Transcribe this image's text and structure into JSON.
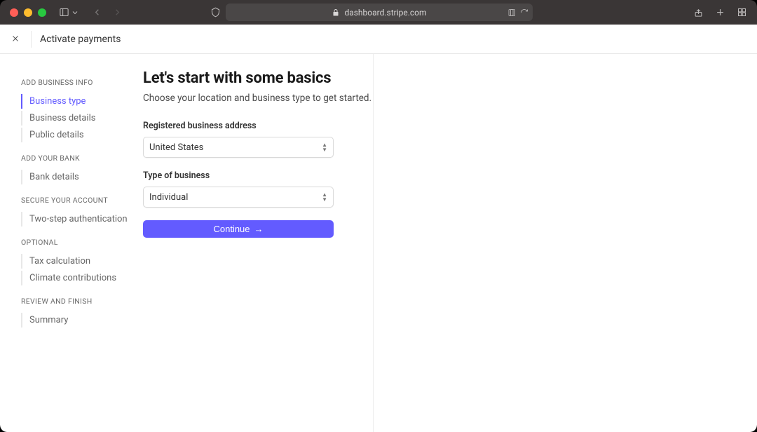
{
  "browser": {
    "url": "dashboard.stripe.com"
  },
  "header": {
    "title": "Activate payments"
  },
  "sidebar": {
    "sections": [
      {
        "title": "ADD BUSINESS INFO",
        "items": [
          {
            "label": "Business type",
            "active": true
          },
          {
            "label": "Business details",
            "active": false
          },
          {
            "label": "Public details",
            "active": false
          }
        ]
      },
      {
        "title": "ADD YOUR BANK",
        "items": [
          {
            "label": "Bank details",
            "active": false
          }
        ]
      },
      {
        "title": "SECURE YOUR ACCOUNT",
        "items": [
          {
            "label": "Two-step authentication",
            "active": false
          }
        ]
      },
      {
        "title": "OPTIONAL",
        "items": [
          {
            "label": "Tax calculation",
            "active": false
          },
          {
            "label": "Climate contributions",
            "active": false
          }
        ]
      },
      {
        "title": "REVIEW AND FINISH",
        "items": [
          {
            "label": "Summary",
            "active": false
          }
        ]
      }
    ]
  },
  "main": {
    "heading": "Let's start with some basics",
    "subheading": "Choose your location and business type to get started.",
    "fields": {
      "address_label": "Registered business address",
      "address_value": "United States",
      "type_label": "Type of business",
      "type_value": "Individual"
    },
    "continue_label": "Continue"
  }
}
